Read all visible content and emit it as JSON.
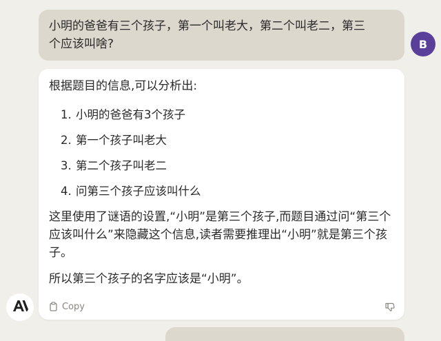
{
  "user_message": {
    "line1": "小明的爸爸有三个孩子，第一个叫老大，第二个叫老二，第三",
    "line2": "个应该叫啥?"
  },
  "user_avatar": {
    "initial": "B",
    "color": "#5a3f9a"
  },
  "assistant": {
    "intro": "根据题目的信息,可以分析出:",
    "points": [
      {
        "num": "1.",
        "text": "小明的爸爸有3个孩子"
      },
      {
        "num": "2.",
        "text": "第一个孩子叫老大"
      },
      {
        "num": "3.",
        "text": "第二个孩子叫老二"
      },
      {
        "num": "4.",
        "text": "问第三个孩子应该叫什么"
      }
    ],
    "explanation": "这里使用了谜语的设置,“小明”是第三个孩子,而题目通过问“第三个应该叫什么”来隐藏这个信息,读者需要推理出“小明”就是第三个孩子。",
    "conclusion": "所以第三个孩子的名字应该是“小明”。",
    "copy_label": "Copy"
  },
  "icons": {
    "copy": "clipboard-icon",
    "feedback": "thumbs-down-icon",
    "ai_logo": "anthropic-logo-icon"
  }
}
